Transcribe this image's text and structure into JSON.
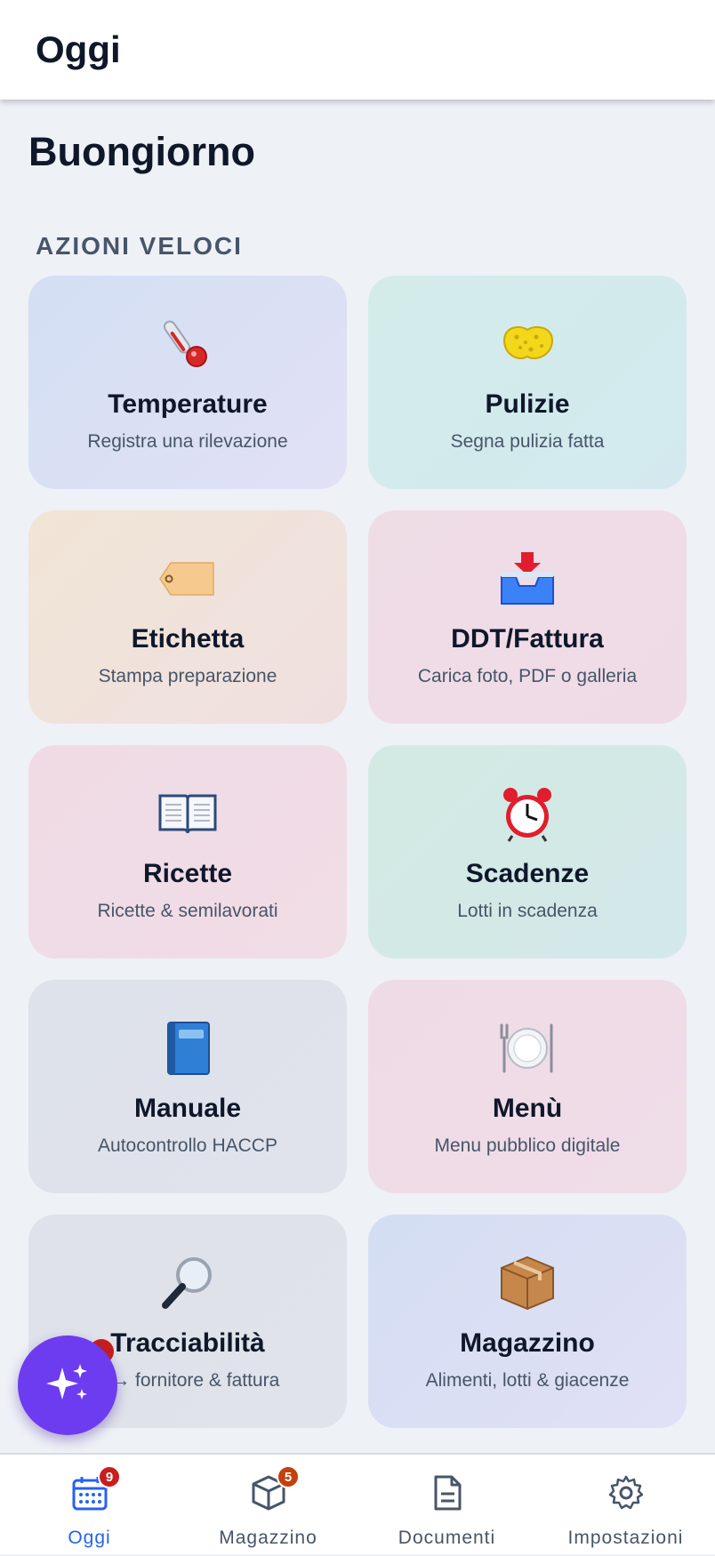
{
  "header": {
    "title": "Oggi"
  },
  "greeting": "Buongiorno",
  "section_label": "AZIONI VELOCI",
  "cards": [
    {
      "icon": "thermometer-icon",
      "title": "Temperature",
      "subtitle": "Registra una rilevazione"
    },
    {
      "icon": "sponge-icon",
      "title": "Pulizie",
      "subtitle": "Segna pulizia fatta"
    },
    {
      "icon": "tag-icon",
      "title": "Etichetta",
      "subtitle": "Stampa preparazione"
    },
    {
      "icon": "inbox-tray-icon",
      "title": "DDT/Fattura",
      "subtitle": "Carica foto, PDF o galleria"
    },
    {
      "icon": "open-book-icon",
      "title": "Ricette",
      "subtitle": "Ricette & semilavorati"
    },
    {
      "icon": "alarm-clock-icon",
      "title": "Scadenze",
      "subtitle": "Lotti in scadenza"
    },
    {
      "icon": "blue-book-icon",
      "title": "Manuale",
      "subtitle": "Autocontrollo HACCP"
    },
    {
      "icon": "plate-cutlery-icon",
      "title": "Menù",
      "subtitle": "Menu pubblico digitale"
    },
    {
      "icon": "magnifier-icon",
      "title": "Tracciabilità",
      "subtitle": "o → fornitore & fattura"
    },
    {
      "icon": "package-icon",
      "title": "Magazzino",
      "subtitle": "Alimenti, lotti & giacenze"
    }
  ],
  "fab": {
    "icon": "sparkles-icon"
  },
  "tabs": [
    {
      "label": "Oggi",
      "icon": "calendar-icon",
      "badge": "9",
      "active": true
    },
    {
      "label": "Magazzino",
      "icon": "box-icon",
      "badge": "5",
      "active": false
    },
    {
      "label": "Documenti",
      "icon": "document-icon",
      "badge": "",
      "active": false
    },
    {
      "label": "Impostazioni",
      "icon": "gear-icon",
      "badge": "",
      "active": false
    }
  ],
  "colors": {
    "accent": "#2563eb",
    "fab": "#6d3bf0",
    "badge_red": "#c81e1e",
    "badge_orange": "#c2410c"
  }
}
